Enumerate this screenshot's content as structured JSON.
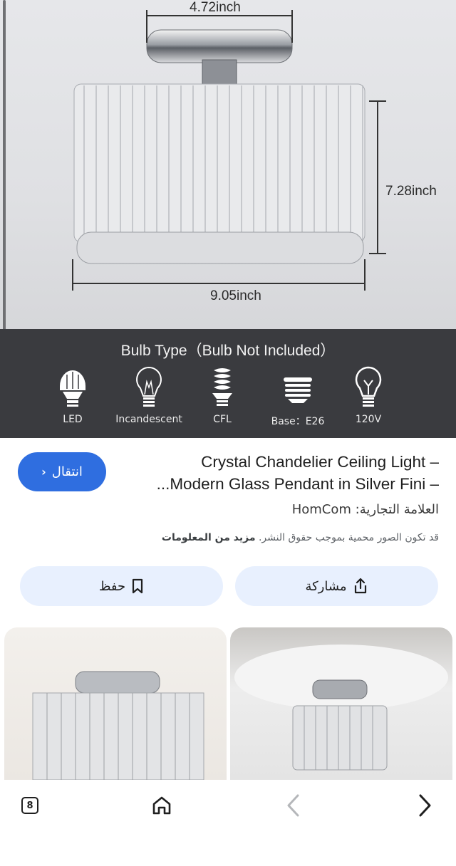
{
  "hero": {
    "dimensions": {
      "width_top": "4.72inch",
      "height": "7.28inch",
      "width_bottom": "9.05inch"
    },
    "bulb_section": {
      "title": "Bulb Type（Bulb Not Included）",
      "items": [
        {
          "label": "LED",
          "icon": "led-bulb-icon"
        },
        {
          "label": "Incandescent",
          "icon": "incandescent-bulb-icon"
        },
        {
          "label": "CFL",
          "icon": "cfl-bulb-icon"
        },
        {
          "label": "Base：E26",
          "icon": "e26-base-icon"
        },
        {
          "label": "120V",
          "icon": "voltage-bulb-icon"
        }
      ]
    }
  },
  "info": {
    "visit_button": "انتقال",
    "title": "Crystal Chandelier Ceiling Light – Modern Glass Pendant in Silver Fini –...",
    "title_line1": "Crystal Chandelier Ceiling Light –",
    "title_line2": "...Modern Glass Pendant in Silver Fini –",
    "brand_label": "العلامة التجارية:",
    "brand_value": "HomCom",
    "copyright_text": "قد تكون الصور محمية بموجب حقوق النشر.",
    "more_info": "مزيد من المعلومات",
    "share_label": "مشاركة",
    "save_label": "حفظ"
  },
  "bottom_nav": {
    "tab_count": "8",
    "icons": [
      "tabs-icon",
      "home-icon",
      "back-icon",
      "forward-icon"
    ]
  },
  "colors": {
    "accent": "#2f6ee0",
    "pill_bg": "#e8f0fe",
    "bulb_band": "#3a3b3f"
  }
}
